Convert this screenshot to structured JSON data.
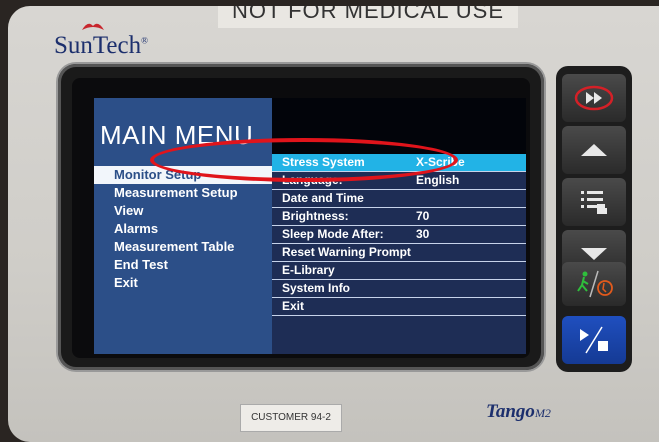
{
  "device": {
    "top_label": "NOT FOR MEDICAL USE",
    "brand_logo": "SunTech",
    "brand_reg": "®",
    "model_name": "Tango",
    "model_suffix": "M2",
    "customer_tag": "CUSTOMER 94-2"
  },
  "screen": {
    "title": "MAIN MENU",
    "main_menu": [
      {
        "label": "Monitor Setup",
        "selected": true
      },
      {
        "label": "Measurement Setup",
        "selected": false
      },
      {
        "label": "View",
        "selected": false
      },
      {
        "label": "Alarms",
        "selected": false
      },
      {
        "label": "Measurement Table",
        "selected": false
      },
      {
        "label": "End Test",
        "selected": false
      },
      {
        "label": "Exit",
        "selected": false
      }
    ],
    "submenu": [
      {
        "label": "Stress System",
        "value": "X-Scribe",
        "highlight": true
      },
      {
        "label": "Language:",
        "value": "English",
        "highlight": false
      },
      {
        "label": "Date and Time",
        "value": "",
        "highlight": false
      },
      {
        "label": "Brightness:",
        "value": "70",
        "highlight": false
      },
      {
        "label": "Sleep Mode After:",
        "value": "30",
        "highlight": false
      },
      {
        "label": "Reset Warning Prompt",
        "value": "",
        "highlight": false
      },
      {
        "label": "E-Library",
        "value": "",
        "highlight": false
      },
      {
        "label": "System Info",
        "value": "",
        "highlight": false
      },
      {
        "label": "Exit",
        "value": "",
        "highlight": false
      }
    ]
  },
  "buttons": [
    {
      "name": "fast-forward-button",
      "icon": "fast-forward-icon"
    },
    {
      "name": "up-button",
      "icon": "arrow-up-icon"
    },
    {
      "name": "menu-button",
      "icon": "menu-list-icon"
    },
    {
      "name": "down-button",
      "icon": "arrow-down-icon"
    },
    {
      "name": "exercise-toggle-button",
      "icon": "walking-person-icon"
    },
    {
      "name": "start-stop-button",
      "icon": "play-stop-icon"
    }
  ],
  "colors": {
    "menu_panel": "#2c4f88",
    "submenu_panel": "#1e2d55",
    "submenu_highlight": "#22b3e6",
    "annotation_circle": "#e0141b",
    "start_button": "#1f4fbf"
  }
}
